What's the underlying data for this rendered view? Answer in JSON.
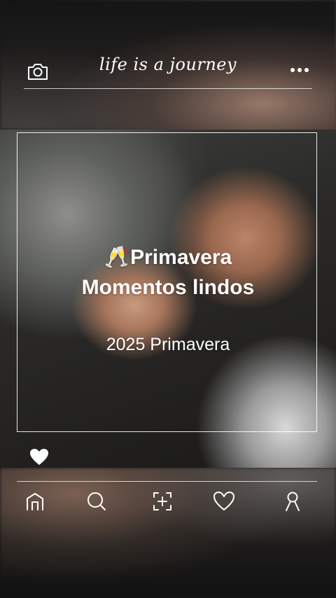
{
  "header": {
    "title": "life is a journey",
    "left_icon": "camera-icon",
    "right_icon": "more-icon"
  },
  "post": {
    "headline_line1": "🥂Primavera",
    "headline_line2": "Momentos lindos",
    "subtitle": "2025 Primavera",
    "like_icon": "heart-icon"
  },
  "nav": {
    "items": [
      {
        "icon": "home-icon"
      },
      {
        "icon": "search-icon"
      },
      {
        "icon": "add-icon"
      },
      {
        "icon": "heart-outline-icon"
      },
      {
        "icon": "profile-icon"
      }
    ]
  },
  "colors": {
    "foreground": "#ffffff",
    "background": "#1a1a1a"
  }
}
